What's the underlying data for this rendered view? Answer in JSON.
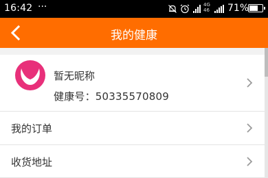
{
  "status_bar": {
    "time": "16:42",
    "more": "···",
    "network": [
      "4G",
      "46"
    ],
    "battery_pct": "71%",
    "battery_level": 0.71
  },
  "navbar": {
    "title": "我的健康",
    "back_icon": "chevron-left-icon"
  },
  "profile": {
    "nickname": "暂无昵称",
    "health_number": "健康号：50335570809",
    "avatar_color": "#e8307a"
  },
  "menu": [
    {
      "label": "我的订单"
    },
    {
      "label": "收货地址"
    }
  ],
  "colors": {
    "accent": "#ff6d00"
  }
}
